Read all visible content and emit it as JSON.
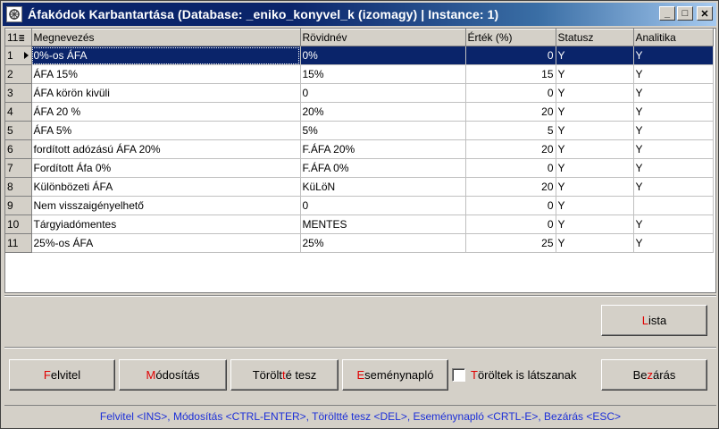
{
  "window": {
    "title": "Áfakódok Karbantartása  (Database: _eniko_konyvel_k (izomagy) | Instance: 1)",
    "controls": {
      "minimize": "_",
      "maximize": "□",
      "close": "✕"
    }
  },
  "grid": {
    "corner_label": "11",
    "columns": [
      "Megnevezés",
      "Rövidnév",
      "Érték (%)",
      "Statusz",
      "Analitika"
    ],
    "rows": [
      {
        "num": "1",
        "megnevezes": "0%-os ÁFA",
        "rovidnev": "0%",
        "ertek": "0",
        "statusz": "Y",
        "analitika": "Y"
      },
      {
        "num": "2",
        "megnevezes": "ÁFA 15%",
        "rovidnev": "15%",
        "ertek": "15",
        "statusz": "Y",
        "analitika": "Y"
      },
      {
        "num": "3",
        "megnevezes": "ÁFA körön kivüli",
        "rovidnev": "0",
        "ertek": "0",
        "statusz": "Y",
        "analitika": "Y"
      },
      {
        "num": "4",
        "megnevezes": "ÁFA 20 %",
        "rovidnev": "20%",
        "ertek": "20",
        "statusz": "Y",
        "analitika": "Y"
      },
      {
        "num": "5",
        "megnevezes": "ÁFA 5%",
        "rovidnev": "5%",
        "ertek": "5",
        "statusz": "Y",
        "analitika": "Y"
      },
      {
        "num": "6",
        "megnevezes": "fordított adózású ÁFA 20%",
        "rovidnev": "F.ÁFA 20%",
        "ertek": "20",
        "statusz": "Y",
        "analitika": "Y"
      },
      {
        "num": "7",
        "megnevezes": "Fordított Áfa 0%",
        "rovidnev": "F.ÁFA 0%",
        "ertek": "0",
        "statusz": "Y",
        "analitika": "Y"
      },
      {
        "num": "8",
        "megnevezes": "Különbözeti ÁFA",
        "rovidnev": "KüLöN",
        "ertek": "20",
        "statusz": "Y",
        "analitika": "Y"
      },
      {
        "num": "9",
        "megnevezes": "Nem visszaigényelhető",
        "rovidnev": "0",
        "ertek": "0",
        "statusz": "Y",
        "analitika": ""
      },
      {
        "num": "10",
        "megnevezes": "Tárgyiadómentes",
        "rovidnev": "MENTES",
        "ertek": "0",
        "statusz": "Y",
        "analitika": "Y"
      },
      {
        "num": "11",
        "megnevezes": "25%-os ÁFA",
        "rovidnev": "25%",
        "ertek": "25",
        "statusz": "Y",
        "analitika": "Y"
      }
    ],
    "selected_row": 0
  },
  "buttons": {
    "lista": {
      "hotkey": "L",
      "rest": "ista"
    },
    "felvitel": {
      "hotkey": "F",
      "rest": "elvitel"
    },
    "modositas": {
      "hotkey": "M",
      "rest": "ódosítás"
    },
    "toroltte_tesz": {
      "pre": "Törölt",
      "hotkey": "t",
      "rest": "é tesz"
    },
    "esemenynaplo": {
      "hotkey": "E",
      "rest": "seménynapló"
    },
    "bezaras": {
      "pre": "Be",
      "hotkey": "z",
      "rest": "árás"
    }
  },
  "checkbox": {
    "hotkey": "T",
    "rest": "öröltek is látszanak",
    "checked": false
  },
  "shortcuts": "Felvitel <INS>,  Módosítás <CTRL-ENTER>,  Töröltté tesz <DEL>,   Eseménynapló <CRTL-E>,  Bezárás <ESC>",
  "colors": {
    "title_bar": "#0a246a",
    "selection": "#0a246a",
    "hotkey": "#e00000",
    "shortcut_text": "#1c2fd8"
  }
}
